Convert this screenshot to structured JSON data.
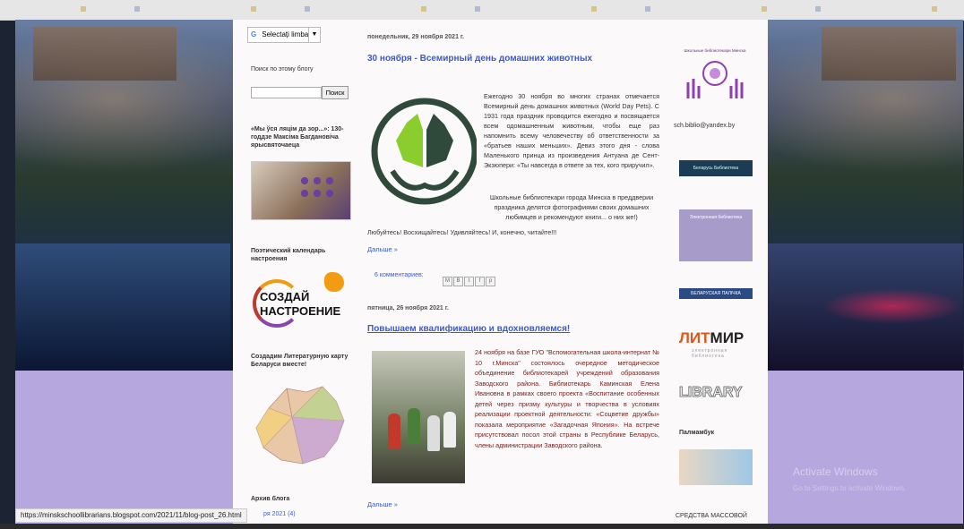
{
  "translate": {
    "label": "Selectați limba",
    "caret": "▼"
  },
  "search": {
    "title": "Поиск по этому блогу",
    "button": "Поиск",
    "value": ""
  },
  "sidebar_left": {
    "promo1": "«Мы ўся ляцім да зор...»: 130-годдзе Максіма Багдановіча ярысвяточаеца",
    "poet_title": "Поэтический календарь настроения",
    "sozdai_line1": "СОЗДАЙ",
    "sozdai_line2": "НАСТРОЕНИЕ",
    "map_title": "Создадим Литературную карту Беларуси вместе!",
    "archive_title": "Архив блога",
    "archive_item": "ря 2021 (4)"
  },
  "post1": {
    "date": "понедельник, 29 ноября 2021 г.",
    "title": "30 ноября - Всемирный день домашних животных",
    "text1": "Ежегодно 30 ноября во многих странах отмечается Всемирный день домашних животных (World Day Pets). С 1931 года праздник проводится ежегодно и посвящается всем одомашненным животным, чтобы еще раз напомнить всему человечеству об ответственности за «братьев наших меньших». Девиз этого дня - слова Маленького принца из произведения Антуана де Сент-Экзюпери: «Ты навсегда в ответе за тех, кого приручил».",
    "text2": "Школьные библиотекари города Минска в преддверии праздника делятся фотографиями своих домашних любимцев и рекомендуют книги... о них же!)",
    "tail": "Любуйтесь! Восхищайтесь! Удивляйтесь! И, конечно, читайте!!!",
    "more": "Дальше »",
    "comments": "6 комментариев:"
  },
  "post2": {
    "date": "пятница, 26 ноября 2021 г.",
    "title": "Повышаем квалификацию и вдохновляемся!",
    "text": "24 ноября на базе ГУО \"Вспомогательная школа-интернат № 10 г.Минска\" состоялось очередное методическое объединение библиотекарей учреждений образования Заводского района. Библиотекарь Каминская Елена Ивановна в рамках своего проекта «Воспитание особенных детей через призму культуры и творчества в условиях реализации проектной деятельности: «Соцветие дружбы» показала мероприятие «Загадочная Япония». На встрече присутствовал посол этой страны в Республике Беларусь, члены администрации Заводского района.",
    "more": "Дальше »"
  },
  "sidebar_right": {
    "logo_text": "Школьные библиотекари Минска",
    "email": "sch.biblio@yandex.by",
    "banner1": "Беларусь Библиотека",
    "banner2": "Электронная библиотека",
    "banner3": "БЕЛАРУСКАЯ ПАЛІЧКА",
    "litmir_lit": "ЛИТ",
    "litmir_mir": "МИР",
    "litmir_sub": "электронная библиотека",
    "library": "LIBRARY",
    "pamlab": "Палмамбук",
    "media": "СРЕДСТВА МАССОВОЙ"
  },
  "watermark": {
    "line1": "Activate Windows",
    "line2": "Go to Settings to activate Windows."
  },
  "status_url": "https://minskschoollibrarians.blogspot.com/2021/11/blog-post_26.html"
}
